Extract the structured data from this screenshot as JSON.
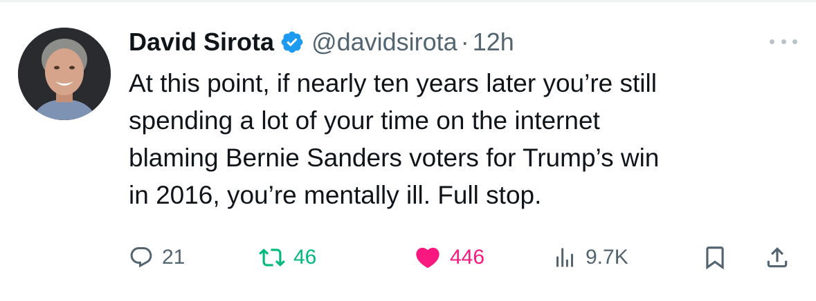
{
  "tweet": {
    "author": {
      "display_name": "David Sirota",
      "verified": true,
      "handle": "@davidsirota",
      "separator": "·",
      "timestamp": "12h"
    },
    "text_lines": [
      "At this point, if nearly ten years later you’re still",
      "spending a lot of your time on the internet",
      "blaming Bernie Sanders voters for Trump’s win",
      "in 2016, you’re mentally ill. Full stop."
    ],
    "stats": {
      "replies": "21",
      "reposts": "46",
      "likes": "446",
      "views": "9.7K"
    }
  },
  "icons": {
    "verified": "verified-badge-icon",
    "more": "more-options-icon",
    "reply": "reply-icon",
    "repost": "repost-icon",
    "like": "heart-icon",
    "views": "views-chart-icon",
    "bookmark": "bookmark-icon",
    "share": "share-icon"
  },
  "colors": {
    "text_primary": "#0f1419",
    "text_secondary": "#536471",
    "verified_blue": "#1d9bf0",
    "repost_green": "#00ba7c",
    "like_pink": "#f91880",
    "divider": "#eff3f4"
  }
}
